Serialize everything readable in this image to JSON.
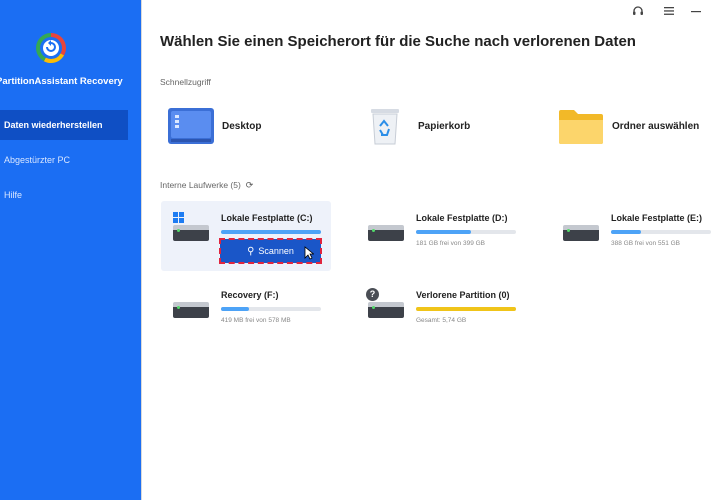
{
  "app": {
    "name": "PartitionAssistant Recovery",
    "colors": {
      "sidebar": "#1b6ef3",
      "active_nav": "#0f4fc4",
      "scan_button": "#1a56c8",
      "usage_bar": "#4da3f7",
      "lost_partition_bar": "#f0c419"
    }
  },
  "sidebar": {
    "items": [
      {
        "label": "Daten wiederherstellen",
        "active": true
      },
      {
        "label": "Abgestürzter PC",
        "active": false
      },
      {
        "label": "Hilfe",
        "active": false
      }
    ]
  },
  "window_controls": {
    "support_icon": "headset-icon",
    "menu_icon": "hamburger-icon",
    "minimize_icon": "minimize-icon"
  },
  "main": {
    "title": "Wählen Sie einen Speicherort für die Suche nach verlorenen Daten",
    "quick_access": {
      "label": "Schnellzugriff",
      "items": [
        {
          "label": "Desktop",
          "icon": "desktop-icon"
        },
        {
          "label": "Papierkorb",
          "icon": "recycle-bin-icon"
        },
        {
          "label": "Ordner auswählen",
          "icon": "folder-icon"
        }
      ]
    },
    "drives_section": {
      "label": "Interne Laufwerke (5)",
      "refresh_icon": "refresh-icon",
      "drives": [
        {
          "name": "Lokale Festplatte (C:)",
          "info": "",
          "usage": 1.0,
          "scan_label": "Scannen",
          "hovered": true
        },
        {
          "name": "Lokale Festplatte (D:)",
          "info": "181 GB frei von 399 GB",
          "usage": 0.55
        },
        {
          "name": "Lokale Festplatte (E:)",
          "info": "388 GB frei von 551 GB",
          "usage": 0.3
        },
        {
          "name": "Recovery (F:)",
          "info": "419 MB frei von 578 MB",
          "usage": 0.28
        },
        {
          "name": "Verlorene Partition (0)",
          "info": "Gesamt: 5,74 GB",
          "usage": 1.0
        }
      ]
    }
  }
}
